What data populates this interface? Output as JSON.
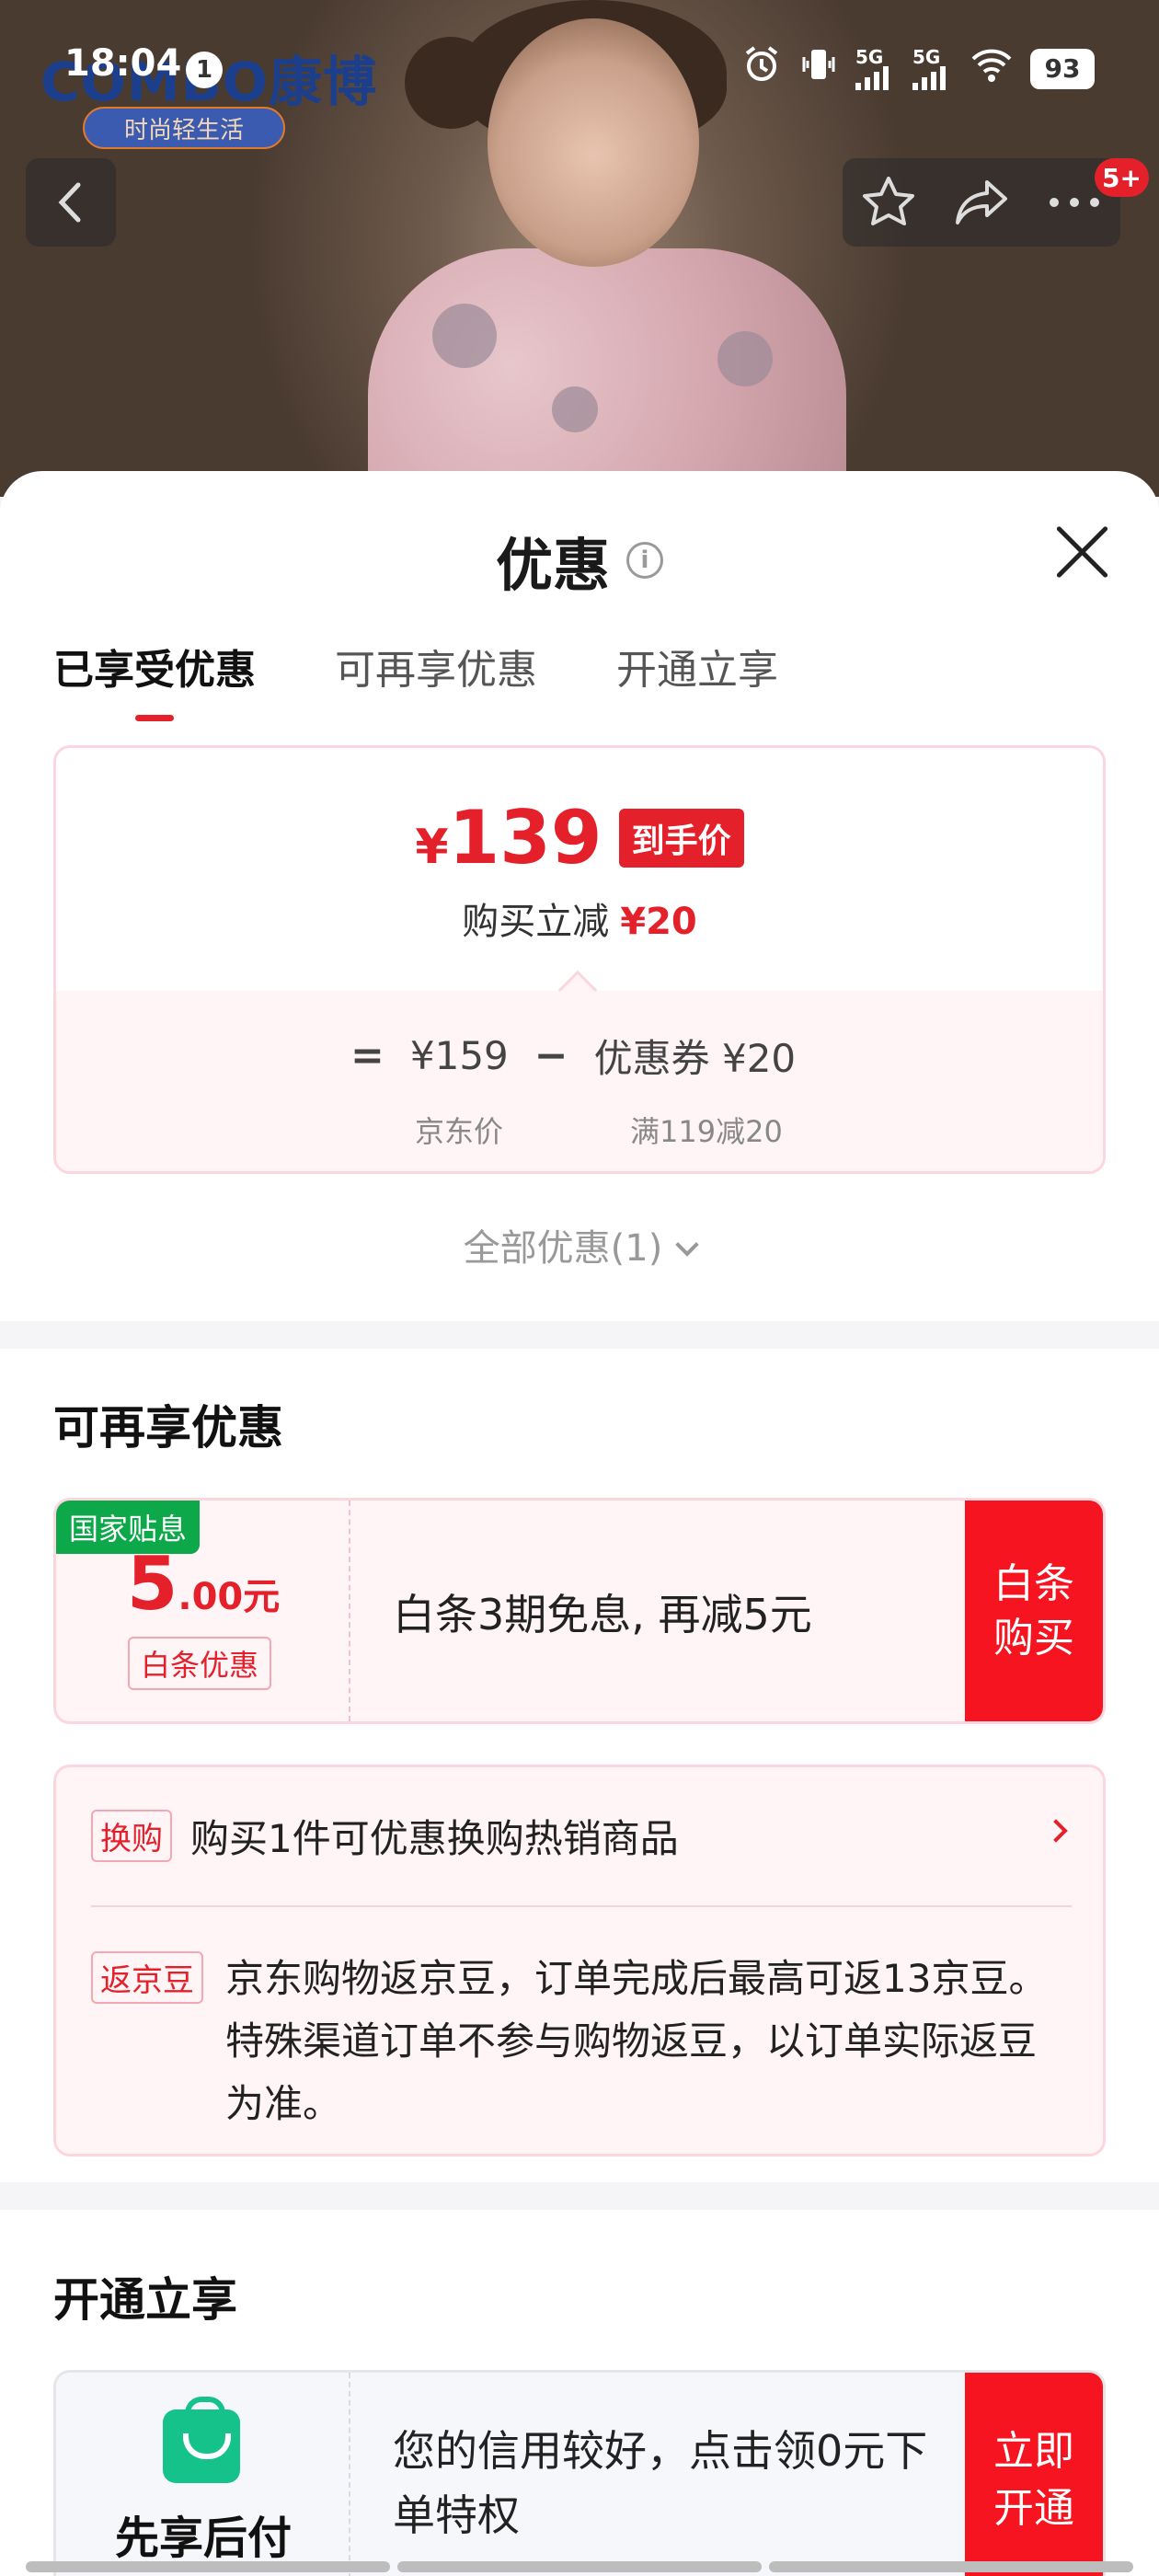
{
  "status_bar": {
    "time": "18:04",
    "notification_count": "1",
    "network_1": "5G",
    "network_2": "5G",
    "battery": "93"
  },
  "brand": {
    "logo_text": "COMBO康博",
    "tagline": "时尚轻生活"
  },
  "header": {
    "badge": "5+"
  },
  "sheet": {
    "title": "优惠",
    "tabs": [
      {
        "label": "已享受优惠",
        "active": true
      },
      {
        "label": "可再享优惠",
        "active": false
      },
      {
        "label": "开通立享",
        "active": false
      }
    ],
    "price_card": {
      "currency": "¥",
      "final_price": "139",
      "final_label": "到手价",
      "reduce_label": "购买立减",
      "reduce_amount": "¥20",
      "equals": "=",
      "jd_price": "¥159",
      "minus": "−",
      "coupon": "优惠券 ¥20",
      "jd_price_label": "京东价",
      "coupon_label": "满119减20"
    },
    "all_discounts": "全部优惠(1)"
  },
  "more_section": {
    "title": "可再享优惠",
    "baitiao": {
      "tag": "国家贴息",
      "amount_int": "5",
      "amount_dec": ".00元",
      "label": "白条优惠",
      "description": "白条3期免息, 再减5元",
      "button_line1": "白条",
      "button_line2": "购买"
    },
    "perks": [
      {
        "tag": "换购",
        "text": "购买1件可优惠换购热销商品"
      },
      {
        "tag": "返京豆",
        "text": "京东购物返京豆，订单完成后最高可返13京豆。特殊渠道订单不参与购物返豆，以订单实际返豆为准。"
      }
    ]
  },
  "open_section": {
    "title": "开通立享",
    "pay_later": {
      "name": "先享后付",
      "description": "您的信用较好，点击领0元下单特权",
      "button_line1": "立即",
      "button_line2": "开通"
    }
  },
  "colors": {
    "accent_red": "#e4202b",
    "button_red": "#f5141f",
    "gov_green": "#0ca84a",
    "pay_green": "#15c38a"
  }
}
